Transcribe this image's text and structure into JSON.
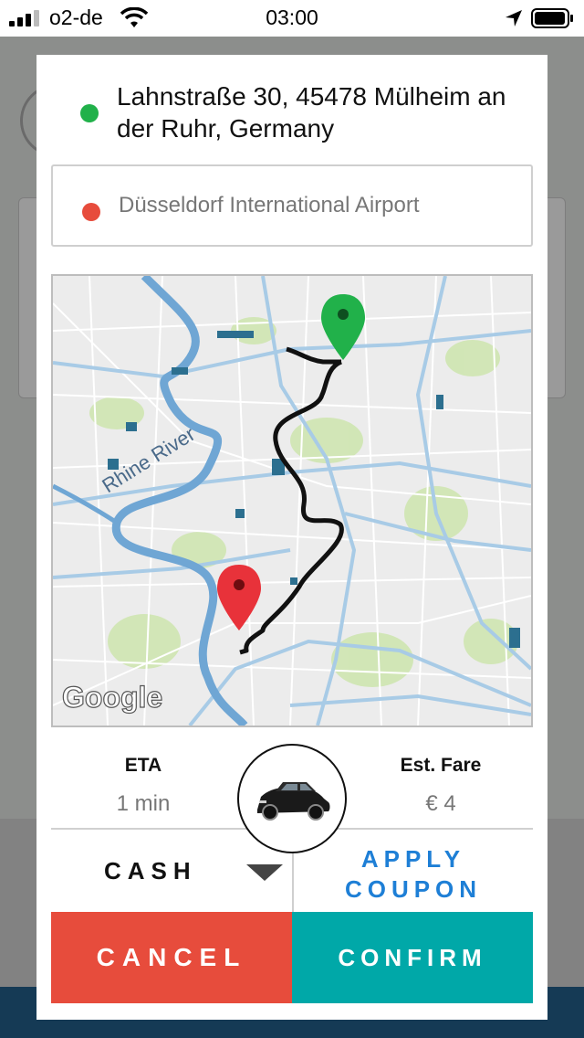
{
  "status_bar": {
    "carrier": "o2-de",
    "time": "03:00"
  },
  "origin": {
    "address": "Lahnstraße 30, 45478 Mülheim an der Ruhr, Germany",
    "marker_color": "#21b14a"
  },
  "destination": {
    "address": "Düsseldorf International Airport",
    "marker_color": "#e74c3c"
  },
  "map": {
    "river_label": "Rhine River",
    "attribution": "Google"
  },
  "trip": {
    "eta_label": "ETA",
    "eta_value": "1 min",
    "fare_label": "Est. Fare",
    "fare_value": "€ 4"
  },
  "payment": {
    "method": "CASH",
    "coupon_label_line1": "APPLY",
    "coupon_label_line2": "COUPON"
  },
  "actions": {
    "cancel_label": "CANCEL",
    "confirm_label": "CONFIRM"
  },
  "colors": {
    "cancel": "#e74c3c",
    "confirm": "#00a8a8",
    "coupon": "#1e7fd6"
  }
}
